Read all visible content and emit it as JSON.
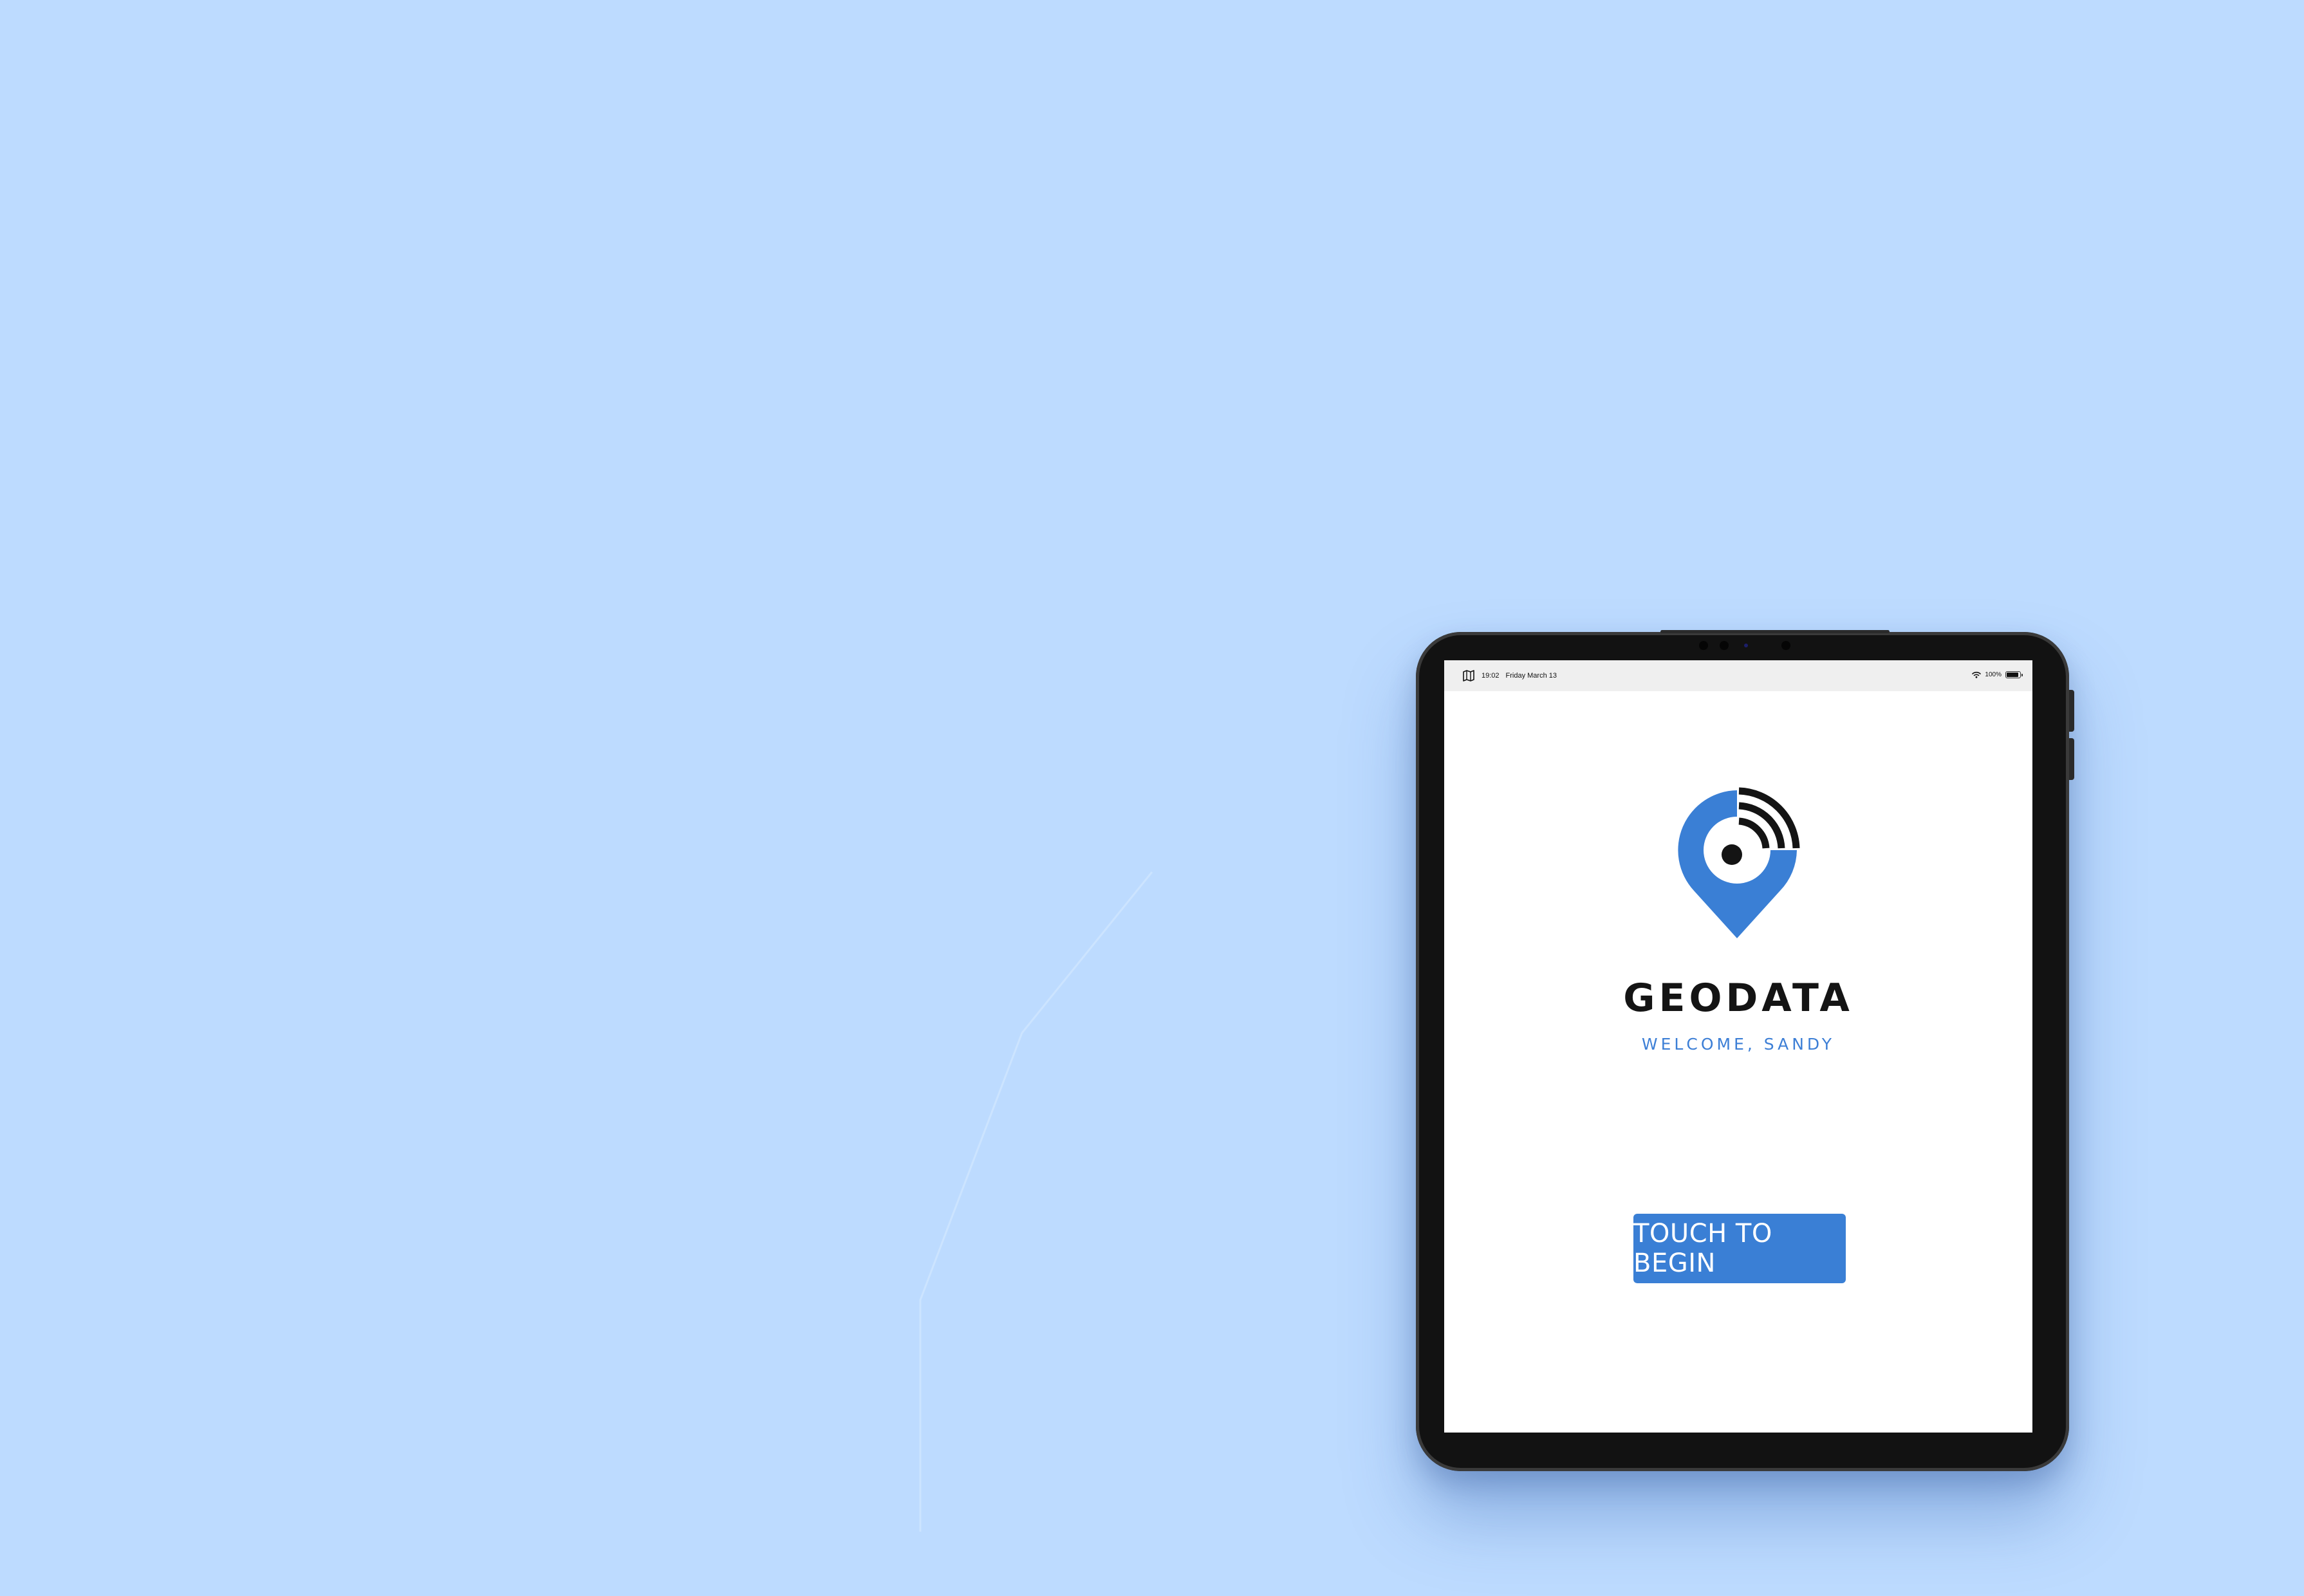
{
  "status_bar": {
    "time": "19:02",
    "date": "Friday March 13",
    "battery_text": "100%",
    "battery_level": 1.0
  },
  "app": {
    "brand_name": "GEODATA",
    "welcome_text": "WELCOME, SANDY",
    "begin_button_label": "TOUCH TO BEGIN"
  },
  "icons": {
    "app_icon": "map-icon",
    "wifi": "wifi-icon",
    "battery": "battery-icon",
    "logo": "location-pin-signal-icon"
  },
  "colors": {
    "background": "#bddbff",
    "accent": "#3a7fd5",
    "text_dark": "#141414"
  }
}
